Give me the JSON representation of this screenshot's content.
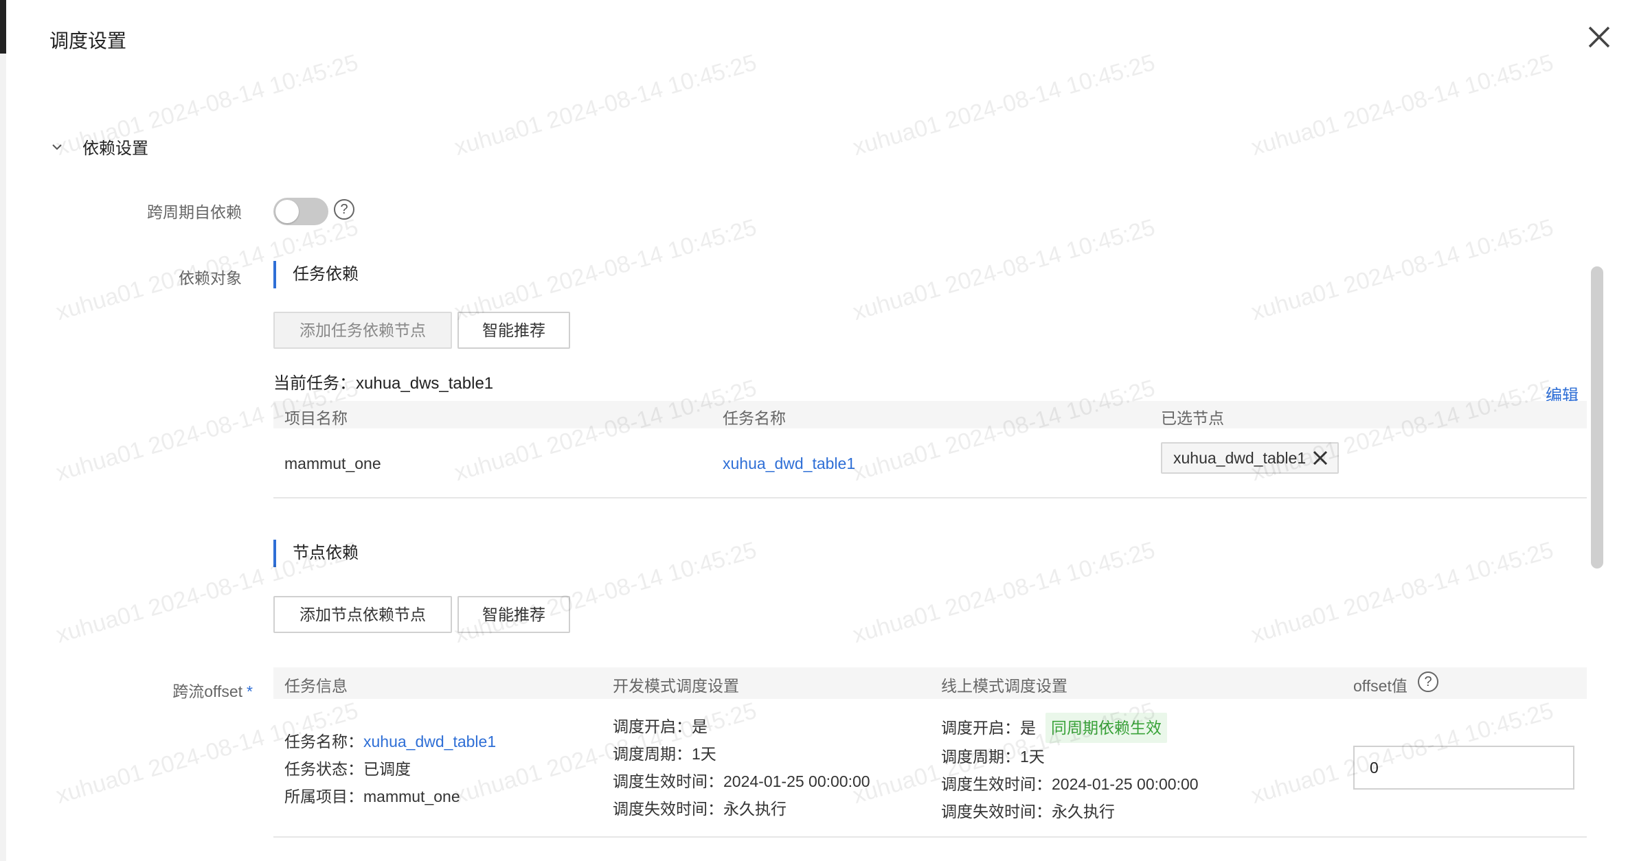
{
  "dialog": {
    "title": "调度设置"
  },
  "section": {
    "title": "依赖设置"
  },
  "cross_cycle": {
    "label": "跨周期自依赖",
    "enabled": false,
    "help": "?"
  },
  "dependency": {
    "label": "依赖对象",
    "task_dep": {
      "heading": "任务依赖",
      "add_button": "添加任务依赖节点",
      "smart_button": "智能推荐",
      "current_task_label": "当前任务：",
      "current_task_value": "xuhua_dws_table1",
      "edit": "编辑",
      "columns": [
        "项目名称",
        "任务名称",
        "已选节点"
      ],
      "rows": [
        {
          "project": "mammut_one",
          "task": "xuhua_dwd_table1",
          "selected_node": "xuhua_dwd_table1"
        }
      ]
    },
    "node_dep": {
      "heading": "节点依赖",
      "add_button": "添加节点依赖节点",
      "smart_button": "智能推荐"
    }
  },
  "offset": {
    "label": "跨流offset",
    "required": "*",
    "columns": [
      "任务信息",
      "开发模式调度设置",
      "线上模式调度设置",
      "offset值"
    ],
    "help": "?",
    "row": {
      "task_name_label": "任务名称：",
      "task_name": "xuhua_dwd_table1",
      "task_status": "任务状态：已调度",
      "task_project": "所属项目：mammut_one",
      "dev": {
        "enabled": "调度开启：是",
        "cycle": "调度周期：1天",
        "start": "调度生效时间：2024-01-25 00:00:00",
        "end": "调度失效时间：永久执行"
      },
      "online": {
        "enabled": "调度开启：是",
        "tag": "同周期依赖生效",
        "cycle": "调度周期：1天",
        "start": "调度生效时间：2024-01-25 00:00:00",
        "end": "调度失效时间：永久执行"
      },
      "offset_value": "0"
    }
  },
  "watermark": "xuhua01 2024-08-14 10:45:25",
  "colors": {
    "accent": "#2f6fd6",
    "success": "#3aa33a",
    "switch_off": "#c9c9c9"
  }
}
